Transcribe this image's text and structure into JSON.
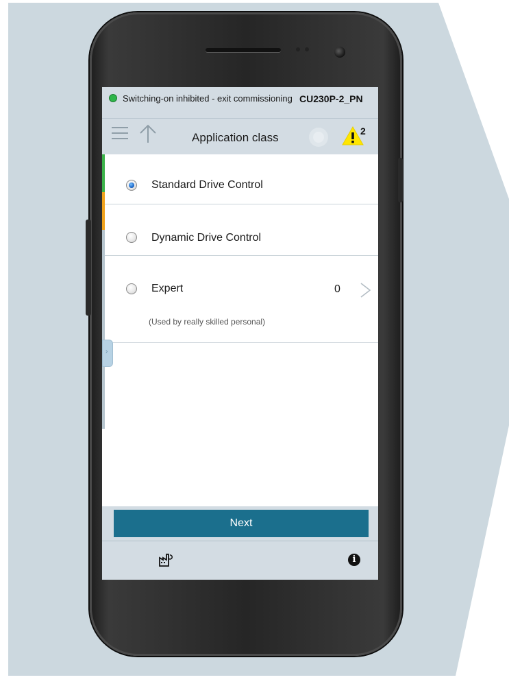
{
  "status_bar": {
    "message": "Switching-on inhibited - exit commissioning",
    "device": "CU230P-2_PN",
    "status_color": "#2fb64a"
  },
  "toolbar": {
    "menu_icon": "hamburger-menu-icon",
    "up_icon": "arrow-up-icon",
    "title": "Application class",
    "stop_icon": "circle-stop-icon",
    "warning_icon": "warning-triangle-icon",
    "warning_count": "2"
  },
  "accent_colors": [
    "#3cb34a",
    "#f0a21c",
    "#b7c6cf"
  ],
  "options": [
    {
      "label": "Standard Drive Control",
      "selected": true
    },
    {
      "label": "Dynamic Drive Control",
      "selected": false
    },
    {
      "label": "Expert",
      "selected": false,
      "subtitle": "(Used by really skilled personal)",
      "count": "0",
      "chevron_icon": "chevron-right-icon"
    }
  ],
  "footer": {
    "next_label": "Next",
    "factory_icon": "factory-reset-icon",
    "info_icon": "info-icon",
    "info_glyph": "i",
    "accent_color": "#1b6f8d"
  }
}
